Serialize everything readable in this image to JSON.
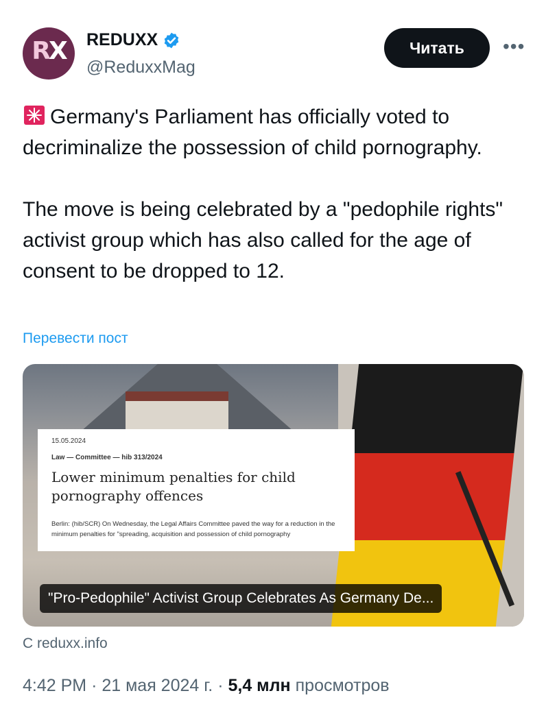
{
  "author": {
    "avatar_text_r": "R",
    "avatar_text_x": "X",
    "display_name": "REDUXX",
    "handle": "@ReduxxMag"
  },
  "header": {
    "read_button": "Читать",
    "more_label": "•••"
  },
  "tweet": {
    "paragraph_1": "Germany's Parliament has officially voted to decriminalize the possession of child pornography.",
    "paragraph_2": "The move is being celebrated by a \"pedophile rights\" activist group which has also called for the age of consent to be dropped to 12.",
    "translate_link": "Перевести пост"
  },
  "card": {
    "document": {
      "date": "15.05.2024",
      "meta": "Law — Committee — hib 313/2024",
      "title": "Lower minimum penalties for child pornography offences",
      "body": "Berlin: (hib/SCR) On Wednesday, the Legal Affairs Committee paved the way for a reduction in the minimum penalties for \"spreading, acquisition and possession of child pornography"
    },
    "caption": "\"Pro-Pedophile\" Activist Group Celebrates As Germany De...",
    "source": "С reduxx.info"
  },
  "footer": {
    "time": "4:42 PM",
    "separator": "·",
    "date": "21 мая 2024 г.",
    "separator_2": "·",
    "views_count": "5,4 млн",
    "views_label": "просмотров"
  },
  "colors": {
    "accent_link": "#1d9bf0",
    "verified": "#1d9bf0",
    "button_bg": "#0f1419",
    "muted_text": "#536471"
  },
  "icons": [
    "verified-badge-icon",
    "alarm-light-icon",
    "more-dots-icon"
  ]
}
